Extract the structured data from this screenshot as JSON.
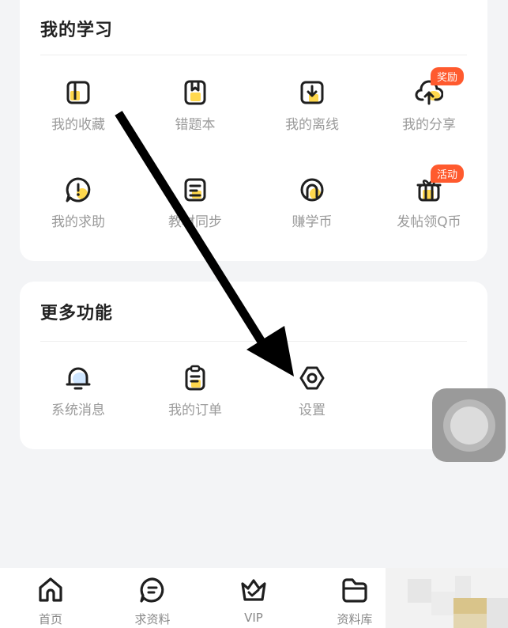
{
  "study": {
    "title": "我的学习",
    "items": [
      {
        "label": "我的收藏",
        "icon": "bookmark-icon"
      },
      {
        "label": "错题本",
        "icon": "notebook-icon"
      },
      {
        "label": "我的离线",
        "icon": "download-icon"
      },
      {
        "label": "我的分享",
        "icon": "cloud-upload-icon",
        "badge": "奖励"
      },
      {
        "label": "我的求助",
        "icon": "help-bubble-icon"
      },
      {
        "label": "教材同步",
        "icon": "textbook-sync-icon"
      },
      {
        "label": "赚学币",
        "icon": "coin-icon"
      },
      {
        "label": "发帖领Q币",
        "icon": "gift-icon",
        "badge": "活动"
      }
    ]
  },
  "more": {
    "title": "更多功能",
    "items": [
      {
        "label": "系统消息",
        "icon": "bell-icon"
      },
      {
        "label": "我的订单",
        "icon": "order-clipboard-icon"
      },
      {
        "label": "设置",
        "icon": "settings-hexagon-icon"
      }
    ]
  },
  "tabbar": {
    "items": [
      {
        "label": "首页",
        "icon": "home-icon"
      },
      {
        "label": "求资料",
        "icon": "chat-bubble-icon"
      },
      {
        "label": "VIP",
        "icon": "crown-icon"
      },
      {
        "label": "资料库",
        "icon": "folder-icon"
      }
    ]
  },
  "colors": {
    "accent": "#ffd84d",
    "badge": "#ff5a2e",
    "icon_stroke": "#1f1f1f",
    "label": "#9a9a9a"
  }
}
